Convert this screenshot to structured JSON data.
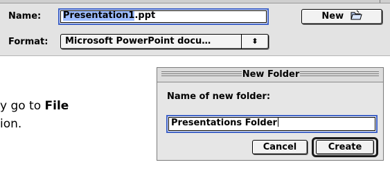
{
  "save_dialog": {
    "name_label": "Name:",
    "name_selected": "Presentation1",
    "name_extension": ".ppt",
    "new_button_label": "New",
    "format_label": "Format:",
    "format_value": "Microsoft PowerPoint docu…",
    "popup_arrows": "⬍"
  },
  "instructions": {
    "line1_prefix": "y go to ",
    "line1_bold": "File",
    "line2": "ion."
  },
  "new_folder_dialog": {
    "title": "New Folder",
    "prompt": "Name of new folder:",
    "folder_name": "Presentations Folder",
    "cancel_label": "Cancel",
    "create_label": "Create"
  },
  "icons": {
    "new_folder_icon": "folder-icon",
    "popup_arrow_icon": "up-down-arrows-icon"
  },
  "colors": {
    "selection": "#9dbcff",
    "focus_ring": "#3f62c7",
    "dialog_bg": "#e6e6e6"
  }
}
